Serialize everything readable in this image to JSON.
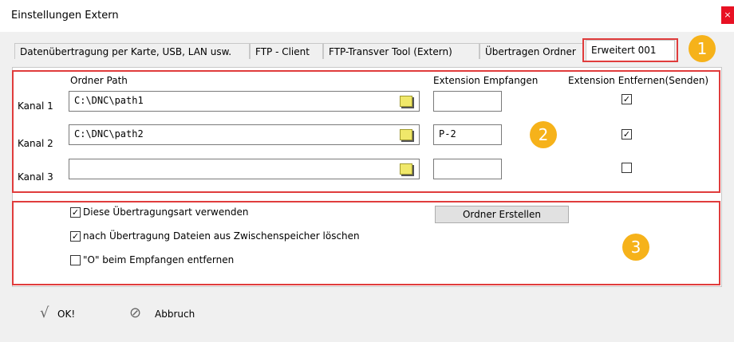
{
  "window": {
    "title": "Einstellungen Extern",
    "close_glyph": "×"
  },
  "tabs": [
    {
      "label": "Datenübertragung per Karte, USB, LAN usw."
    },
    {
      "label": "FTP - Client"
    },
    {
      "label": "FTP-Transver Tool (Extern)"
    },
    {
      "label": "Übertragen Ordner"
    },
    {
      "label": "Erweitert 001",
      "active": true
    }
  ],
  "annotations": {
    "badge1": "1",
    "badge2": "2",
    "badge3": "3",
    "highlight_color": "#e03c3c",
    "badge_color": "#f6b21a"
  },
  "channels": {
    "header_path": "Ordner Path",
    "header_ext_receive": "Extension Empfangen",
    "header_ext_remove": "Extension Entfernen(Senden)",
    "rows": [
      {
        "label": "Kanal 1",
        "path": "C:\\DNC\\path1",
        "ext": "",
        "remove_checked": true
      },
      {
        "label": "Kanal 2",
        "path": "C:\\DNC\\path2",
        "ext": "P-2",
        "remove_checked": true
      },
      {
        "label": "Kanal 3",
        "path": "",
        "ext": "",
        "remove_checked": false
      }
    ]
  },
  "options": {
    "use_transfer": {
      "label": "Diese Übertragungsart verwenden",
      "checked": true
    },
    "delete_cache": {
      "label": "nach Übertragung Dateien aus Zwischenspeicher löschen",
      "checked": true
    },
    "remove_o": {
      "label": "\"O\" beim Empfangen entfernen",
      "checked": false
    },
    "create_folder_button": "Ordner Erstellen"
  },
  "footer": {
    "ok_label": "OK!",
    "cancel_label": "Abbruch",
    "ok_icon": "checkmark-icon",
    "cancel_icon": "prohibited-icon"
  }
}
